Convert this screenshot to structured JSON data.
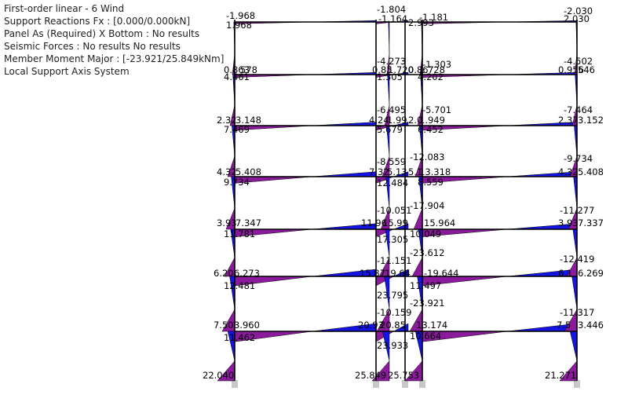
{
  "info_panel": {
    "line1": "First-order linear - 6 Wind",
    "line2": "Support Reactions Fx : [0.000/0.000kN]",
    "line3": "Panel As (Required) X Bottom : No results",
    "line4": "Seismic Forces : No results No results",
    "line5": "Member Moment Major  : [-23.921/25.849kNm]",
    "line6": "Local Support Axis System"
  },
  "colors": {
    "positive_moment": "#8b1a9c",
    "negative_moment": "#1414e6",
    "member": "#000000",
    "support": "#c8c8c8"
  },
  "moment_labels": [
    "-1.968",
    "1.968",
    "-2.030",
    "2.030",
    "-1.804",
    "-1.164",
    "2.993",
    "-1.181",
    "0.863",
    "578",
    "4.461",
    "-4.273",
    "0.85",
    "1.720",
    "0.86",
    "1.728",
    "1.305",
    "-1.303",
    "4.202",
    "-4.502",
    "0.956",
    "546",
    "2.32",
    "3.148",
    "7.469",
    "-6.495",
    "4.24",
    "1.99",
    "2.0",
    "1.949",
    "5.679",
    "-5.701",
    "6.452",
    "-7.464",
    "2.37",
    "3.152",
    "4.32",
    "5.408",
    "9.734",
    "-8.559",
    "7.32",
    "5.13",
    "5.1",
    "13.318",
    "12.484",
    "-12.083",
    "8.559",
    "-9.734",
    "4.32",
    "5.408",
    "3.93",
    "7.347",
    "11.781",
    "-10.051",
    "11.96",
    "15.99",
    "15.964",
    "17.305",
    "-17.904",
    "10.049",
    "-11.277",
    "3.93",
    "7.337",
    "6.20",
    "6.273",
    "12.481",
    "-11.151",
    "15.87",
    "19.64",
    "-19.644",
    "23.795",
    "-23.612",
    "11.497",
    "-12.419",
    "6.1",
    "6.269",
    "7.50",
    "3.960",
    "11.462",
    "-10.159",
    "20.93",
    "20.85",
    "13.174",
    "23.933",
    "-23.921",
    "10.664",
    "-11.317",
    "7.5",
    "3.446",
    "22.040",
    "25.849",
    "25.753",
    "21.271"
  ]
}
